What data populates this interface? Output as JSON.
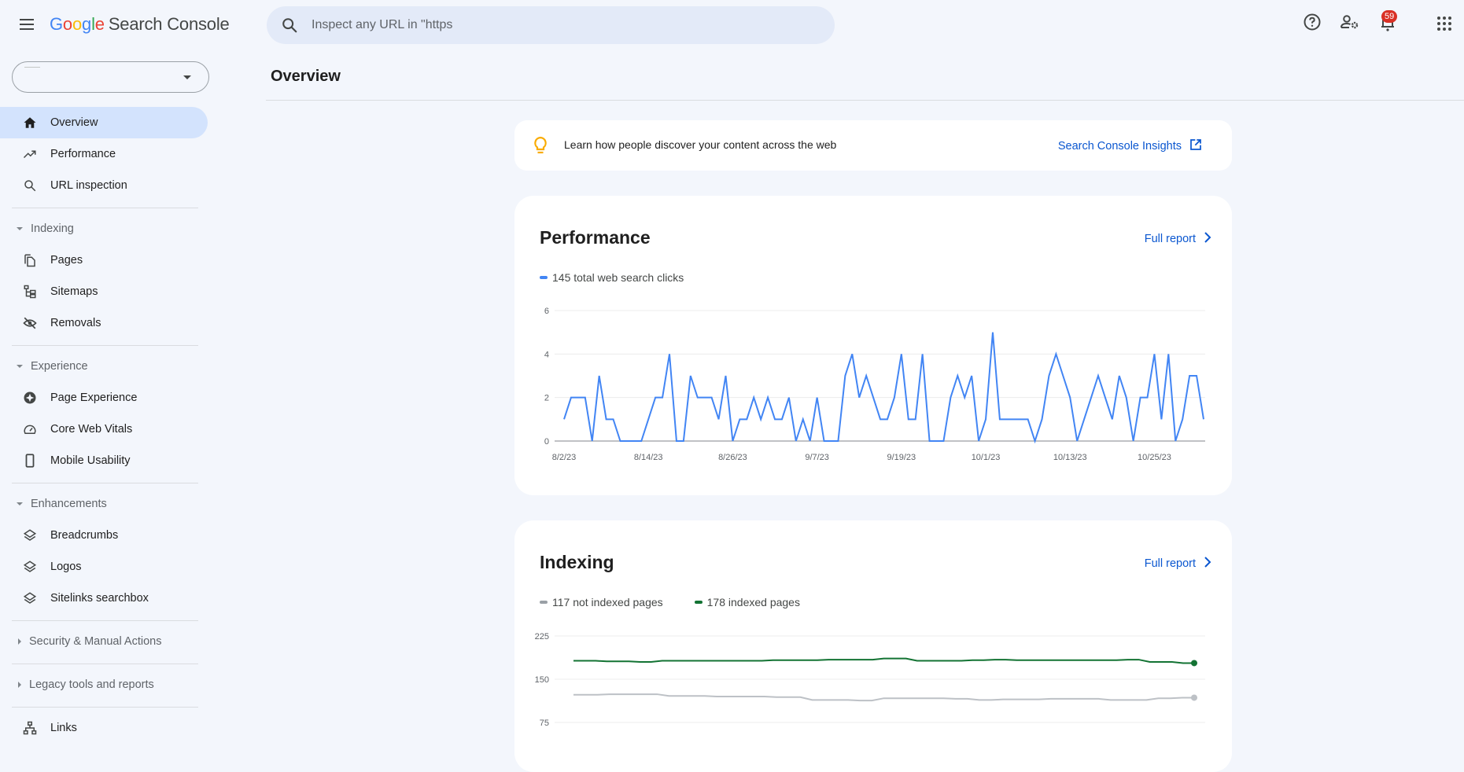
{
  "app": {
    "logo_letters": [
      "G",
      "o",
      "o",
      "g",
      "l",
      "e"
    ],
    "product_name": "Search Console"
  },
  "header": {
    "search_placeholder": "Inspect any URL in \"https",
    "icons": [
      "help-icon",
      "manage-users-icon",
      "notifications-icon",
      "apps-grid-icon"
    ],
    "notification_count": "59"
  },
  "sidebar": {
    "property_selector_value": "",
    "items": [
      {
        "label": "Overview",
        "icon": "home-icon",
        "active": true
      },
      {
        "label": "Performance",
        "icon": "trending-up-icon"
      },
      {
        "label": "URL inspection",
        "icon": "search-icon"
      }
    ],
    "sections": {
      "indexing": {
        "label": "Indexing",
        "expanded": true,
        "items": [
          {
            "label": "Pages",
            "icon": "pages-icon"
          },
          {
            "label": "Sitemaps",
            "icon": "sitemap-icon"
          },
          {
            "label": "Removals",
            "icon": "visibility-off-icon"
          }
        ]
      },
      "experience": {
        "label": "Experience",
        "expanded": true,
        "items": [
          {
            "label": "Page Experience",
            "icon": "page-experience-icon"
          },
          {
            "label": "Core Web Vitals",
            "icon": "speed-gauge-icon"
          },
          {
            "label": "Mobile Usability",
            "icon": "smartphone-icon"
          }
        ]
      },
      "enhancements": {
        "label": "Enhancements",
        "expanded": true,
        "items": [
          {
            "label": "Breadcrumbs",
            "icon": "layers-icon"
          },
          {
            "label": "Logos",
            "icon": "layers-icon"
          },
          {
            "label": "Sitelinks searchbox",
            "icon": "layers-icon"
          }
        ]
      },
      "security": {
        "label": "Security & Manual Actions",
        "expanded": false
      },
      "legacy": {
        "label": "Legacy tools and reports",
        "expanded": false
      }
    },
    "bottom_items": [
      {
        "label": "Links",
        "icon": "links-tree-icon"
      }
    ]
  },
  "main": {
    "page_title": "Overview",
    "insights_banner": {
      "text": "Learn how people discover your content across the web",
      "link_label": "Search Console Insights"
    },
    "performance_card": {
      "title": "Performance",
      "full_report_label": "Full report",
      "legend": [
        {
          "label": "145 total web search clicks",
          "color": "#4285f4"
        }
      ]
    },
    "indexing_card": {
      "title": "Indexing",
      "full_report_label": "Full report",
      "legend": [
        {
          "label": "117 not indexed pages",
          "color": "#9aa0a6"
        },
        {
          "label": "178 indexed pages",
          "color": "#137333"
        }
      ]
    }
  },
  "colors": {
    "accent_blue": "#0b57d0",
    "clicks_line": "#4285f4",
    "indexed_line": "#137333",
    "not_indexed_line": "#bdc1c6",
    "active_nav_bg": "#d3e3fd",
    "badge_red": "#d93025",
    "bulb_yellow": "#f9ab00"
  },
  "chart_data": [
    {
      "type": "line",
      "title": "Performance",
      "series": [
        {
          "name": "145 total web search clicks",
          "color": "#4285f4",
          "values": [
            1,
            2,
            2,
            2,
            0,
            3,
            1,
            1,
            0,
            0,
            0,
            0,
            1,
            2,
            2,
            4,
            0,
            0,
            3,
            2,
            2,
            2,
            1,
            3,
            0,
            1,
            1,
            2,
            1,
            2,
            1,
            1,
            2,
            0,
            1,
            0,
            2,
            0,
            0,
            0,
            3,
            4,
            2,
            3,
            2,
            1,
            1,
            2,
            4,
            1,
            1,
            4,
            0,
            0,
            0,
            2,
            3,
            2,
            3,
            0,
            1,
            5,
            1,
            1,
            1,
            1,
            1,
            0,
            1,
            3,
            4,
            3,
            2,
            0,
            1,
            2,
            3,
            2,
            1,
            3,
            2,
            0,
            2,
            2,
            4,
            1,
            4,
            0,
            1,
            3,
            3,
            1
          ]
        }
      ],
      "x_tick_labels": [
        "8/2/23",
        "8/14/23",
        "8/26/23",
        "9/7/23",
        "9/19/23",
        "10/1/23",
        "10/13/23",
        "10/25/23"
      ],
      "x_tick_day_index": [
        0,
        12,
        24,
        36,
        48,
        60,
        72,
        84
      ],
      "y_ticks": [
        0,
        2,
        4,
        6
      ],
      "ylim": [
        0,
        6
      ],
      "grid": true,
      "legend_position": "top-left"
    },
    {
      "type": "line",
      "title": "Indexing",
      "series": [
        {
          "name": "117 not indexed pages",
          "color": "#bdc1c6",
          "values": [
            123,
            123,
            123,
            124,
            124,
            124,
            124,
            124,
            121,
            121,
            121,
            121,
            120,
            120,
            120,
            120,
            120,
            119,
            119,
            119,
            114,
            114,
            114,
            114,
            113,
            113,
            117,
            117,
            117,
            117,
            117,
            117,
            116,
            116,
            114,
            114,
            115,
            115,
            115,
            115,
            116,
            116,
            116,
            116,
            116,
            114,
            114,
            114,
            114,
            117,
            117,
            118,
            118
          ]
        },
        {
          "name": "178 indexed pages",
          "color": "#137333",
          "values": [
            182,
            182,
            182,
            181,
            181,
            181,
            180,
            180,
            182,
            182,
            182,
            182,
            182,
            182,
            182,
            182,
            182,
            182,
            183,
            183,
            183,
            183,
            183,
            184,
            184,
            184,
            184,
            184,
            186,
            186,
            186,
            182,
            182,
            182,
            182,
            182,
            183,
            183,
            184,
            184,
            183,
            183,
            183,
            183,
            183,
            183,
            183,
            183,
            183,
            183,
            184,
            184,
            180,
            180,
            180,
            178,
            178
          ]
        }
      ],
      "y_ticks": [
        75,
        150,
        225
      ],
      "ylim": [
        30,
        240
      ],
      "grid": true,
      "legend_position": "top-left"
    }
  ]
}
